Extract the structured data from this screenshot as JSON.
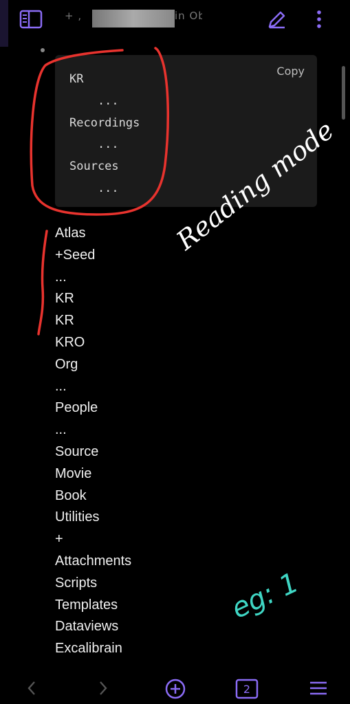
{
  "header": {
    "title": "+ ,",
    "title_suffix": "in Ober",
    "accent": "#8b6cf6"
  },
  "code_block": {
    "lines": [
      "KR",
      "    ...",
      "Recordings",
      "    ...",
      "Sources",
      "    ..."
    ],
    "copy_label": "Copy"
  },
  "tree": {
    "items": [
      "Atlas",
      "+Seed",
      "...",
      "KR",
      "KR",
      "KRO",
      "Org",
      "...",
      "People",
      "...",
      "Source",
      "Movie",
      "Book",
      "Utilities",
      "+",
      "Attachments",
      "Scripts",
      "Templates",
      "Dataviews",
      "Excalibrain"
    ]
  },
  "bottom_bar": {
    "tab_count": "2"
  },
  "annotations": {
    "reading_mode": "Reading mode",
    "example": "eg: 1",
    "red": "#e8332e",
    "cyan": "#3fd6c4"
  }
}
